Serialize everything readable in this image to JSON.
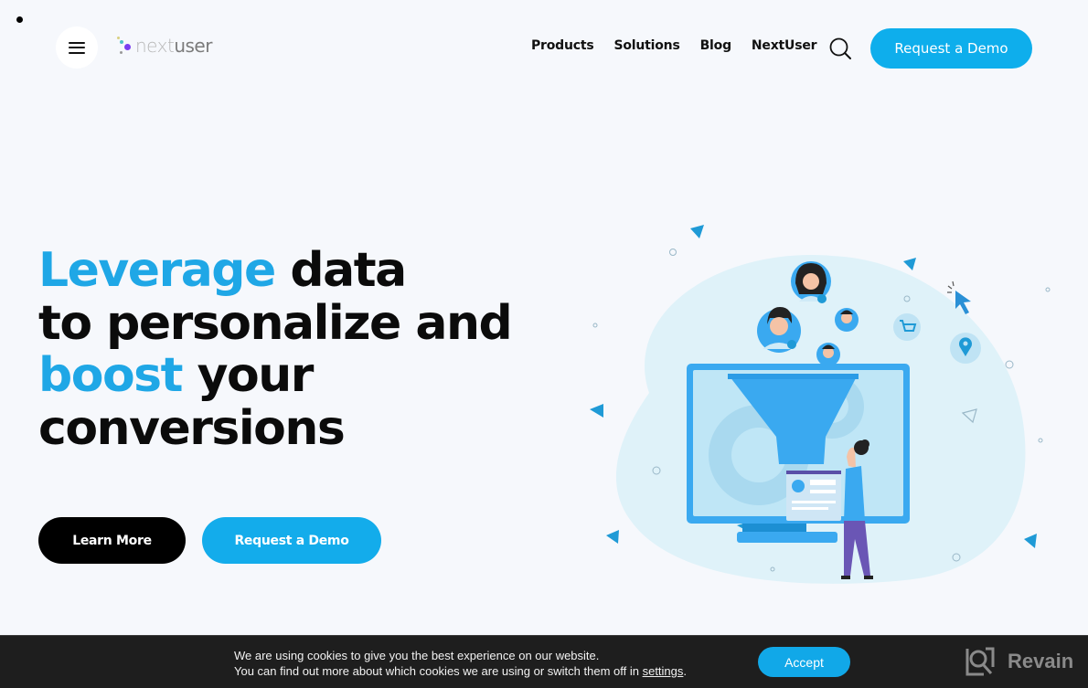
{
  "header": {
    "logo": {
      "part1": "next",
      "part2": "user"
    },
    "nav": [
      {
        "label": "Products"
      },
      {
        "label": "Solutions"
      },
      {
        "label": "Blog"
      },
      {
        "label": "NextUser"
      }
    ],
    "icons": {
      "menu": "hamburger-menu-icon",
      "search": "search-icon"
    },
    "cta_label": "Request a Demo"
  },
  "hero": {
    "title": {
      "line1_accent": "Leverage",
      "line1_rest": " data",
      "line2": "to personalize and",
      "line3_accent": "boost",
      "line3_rest": " your",
      "line4": "conversions"
    },
    "buttons": {
      "learn_more": "Learn More",
      "request_demo": "Request a Demo"
    },
    "illustration": "sales-funnel-personalization-illustration"
  },
  "cookie_banner": {
    "line1": "We are using cookies to give you the best experience on our website.",
    "line2_prefix": "You can find out more about which cookies we are using or switch them off in ",
    "settings_link": "settings",
    "line2_suffix": ".",
    "accept_label": "Accept"
  },
  "watermark": {
    "label": "Revain"
  },
  "colors": {
    "accent": "#1fa7e6",
    "button_blue": "#0eaeec",
    "background": "#f6f8fc",
    "banner_bg": "#1e1e1e",
    "text": "#0b0b0b"
  }
}
